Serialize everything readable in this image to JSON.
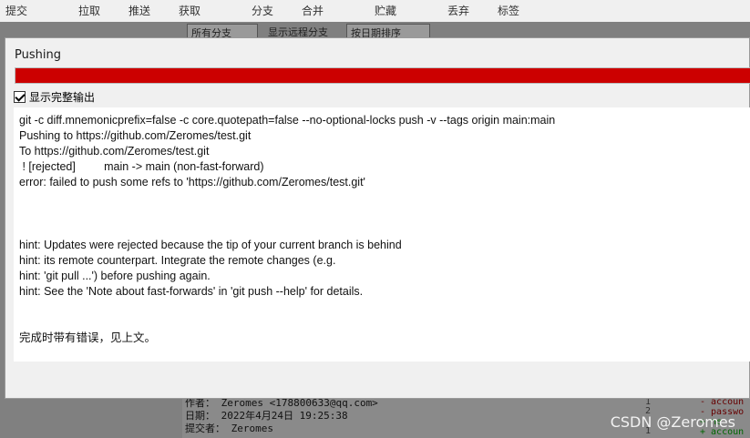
{
  "toolbar": {
    "items": [
      "提交",
      "拉取",
      "推送",
      "获取",
      "分支",
      "合并",
      "贮藏",
      "丢弃",
      "标签"
    ]
  },
  "filterbar": {
    "branch_select": "所有分支",
    "show_remote": "显示远程分支",
    "sort_select": "按日期排序"
  },
  "dialog": {
    "title": "Pushing",
    "progress_percent": 100,
    "progress_color": "#cc0000",
    "show_full_output": "显示完整输出",
    "output_lines": [
      "git -c diff.mnemonicprefix=false -c core.quotepath=false --no-optional-locks push -v --tags origin main:main",
      "Pushing to https://github.com/Zeromes/test.git",
      "To https://github.com/Zeromes/test.git",
      " ! [rejected]         main -> main (non-fast-forward)",
      "error: failed to push some refs to 'https://github.com/Zeromes/test.git'",
      "",
      "",
      "",
      "hint: Updates were rejected because the tip of your current branch is behind",
      "hint: its remote counterpart. Integrate the remote changes (e.g.",
      "hint: 'git pull ...') before pushing again.",
      "hint: See the 'Note about fast-forwards' in 'git push --help' for details.",
      "",
      "",
      "完成时带有错误，见上文。"
    ]
  },
  "commit_details": {
    "author": "作者： Zeromes <178800633@qq.com>",
    "date": "日期： 2022年4月24日 19:25:38",
    "committer": "提交者： Zeromes"
  },
  "diff": {
    "lines": [
      "- accoun",
      "- passwo",
      "+ ne",
      "+ accoun"
    ],
    "numbers": [
      "1",
      "2",
      "",
      "1"
    ]
  },
  "watermark": "CSDN @Zeromes"
}
